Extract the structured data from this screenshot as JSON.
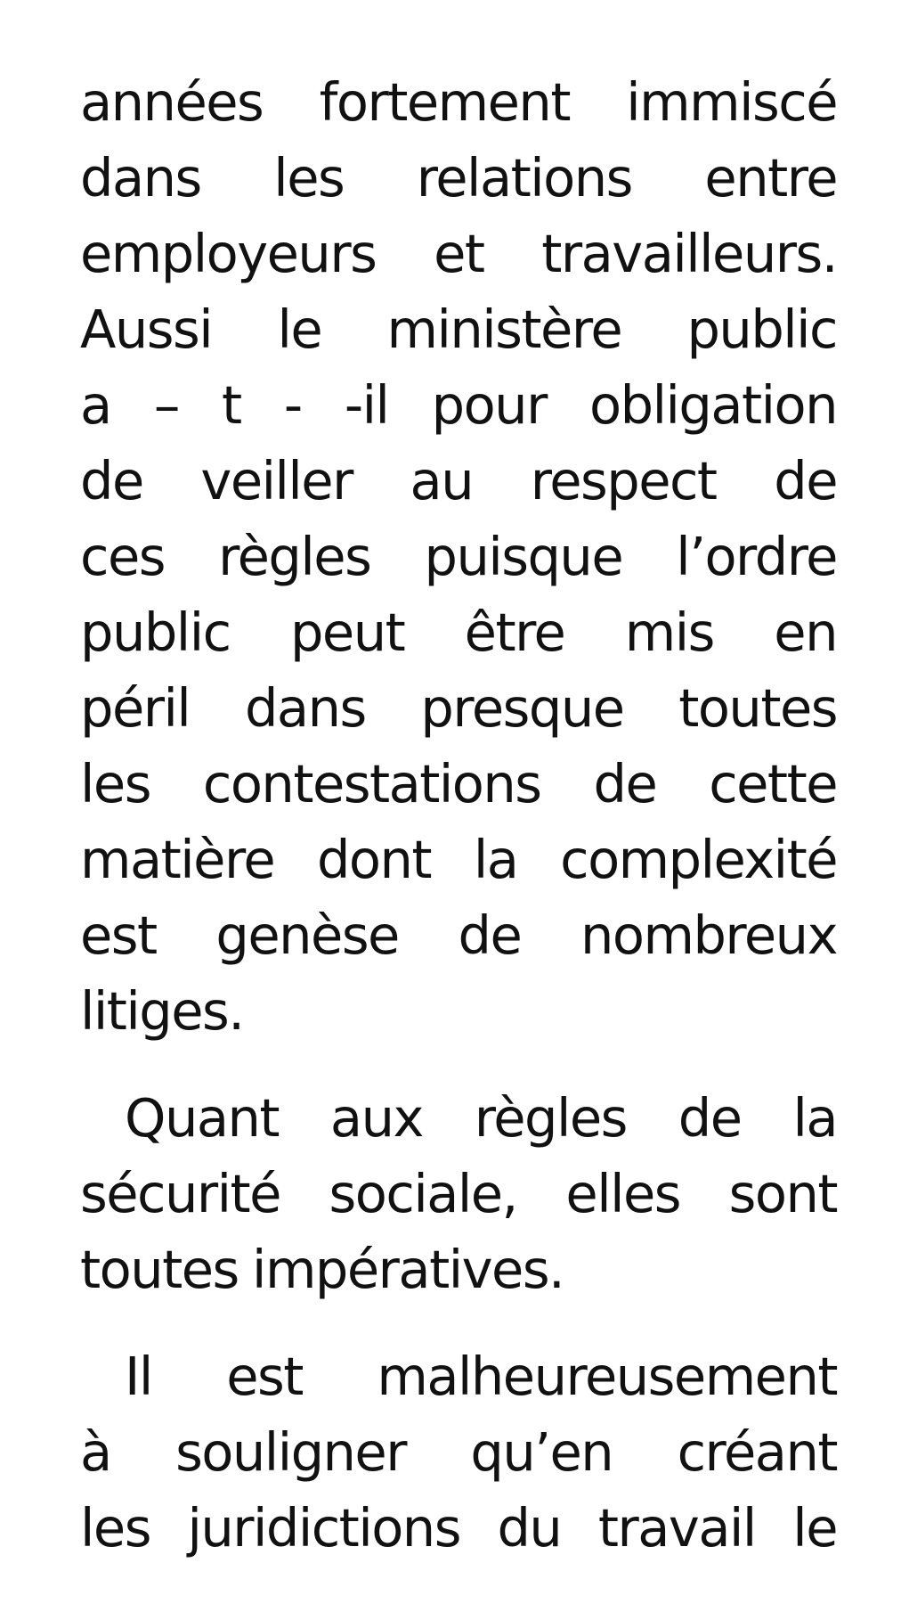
{
  "paragraphs": [
    {
      "lines": [
        "années fortement immiscé",
        "dans les relations entre",
        "employeurs et travailleurs.",
        "Aussi le ministère public",
        "a – t - -il pour obligation",
        "de veiller au respect de",
        "ces règles puisque l’ordre",
        "public peut être mis en",
        "péril dans presque toutes",
        "les contestations de cette",
        "matière dont la complexité",
        "est  genèse de nombreux",
        "litiges."
      ]
    },
    {
      "lines": [
        "Quant aux règles de la",
        "sécurité sociale, elles sont",
        "toutes impératives."
      ]
    },
    {
      "lines": [
        "Il est malheureusement",
        "à  souligner qu’en créant",
        "les juridictions du travail le"
      ]
    }
  ]
}
